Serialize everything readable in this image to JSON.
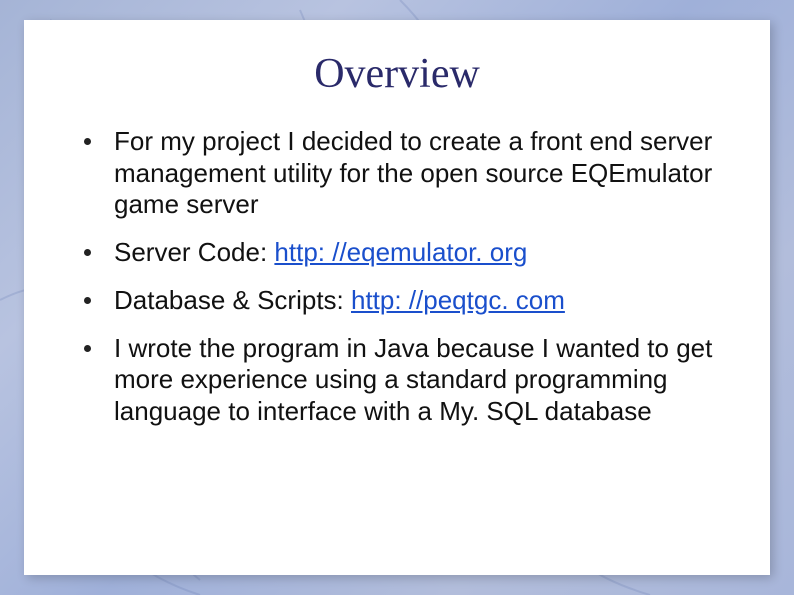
{
  "title": "Overview",
  "bullets": [
    {
      "text": "For my project I decided to create a front end server management utility for the open source EQEmulator game server"
    },
    {
      "prefix": "Server Code: ",
      "link": "http: //eqemulator. org"
    },
    {
      "prefix": "Database & Scripts: ",
      "link": "http: //peqtgc. com"
    },
    {
      "text": "I wrote the program in Java because I wanted to get more experience using a standard programming language to interface with a My. SQL database"
    }
  ]
}
